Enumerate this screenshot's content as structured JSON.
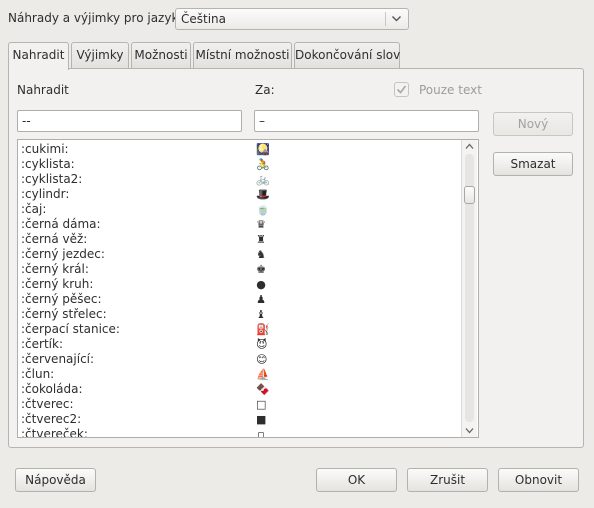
{
  "header": {
    "language_label": "Náhrady a výjimky pro jazyk:",
    "language_value": "Čeština"
  },
  "tabs": [
    {
      "label": "Nahradit",
      "active": true
    },
    {
      "label": "Výjimky",
      "active": false
    },
    {
      "label": "Možnosti",
      "active": false
    },
    {
      "label": "Místní možnosti",
      "active": false
    },
    {
      "label": "Dokončování slov",
      "active": false
    }
  ],
  "replace": {
    "col_replace_label": "Nahradit",
    "col_with_label": "Za:",
    "text_only_label": "Pouze text",
    "text_only_checked": true,
    "text_only_enabled": false,
    "replace_value": "--",
    "with_value": "–",
    "new_button": "Nový",
    "delete_button": "Smazat"
  },
  "list": [
    {
      "key": ":cukimi:",
      "value": "🎑"
    },
    {
      "key": ":cyklista:",
      "value": "🚴"
    },
    {
      "key": ":cyklista2:",
      "value": "🚲"
    },
    {
      "key": ":cylindr:",
      "value": "🎩"
    },
    {
      "key": ":čaj:",
      "value": "🍵"
    },
    {
      "key": ":černá dáma:",
      "value": "♛"
    },
    {
      "key": ":černá věž:",
      "value": "♜"
    },
    {
      "key": ":černý jezdec:",
      "value": "♞"
    },
    {
      "key": ":černý král:",
      "value": "♚"
    },
    {
      "key": ":černý kruh:",
      "value": "●"
    },
    {
      "key": ":černý pěšec:",
      "value": "♟"
    },
    {
      "key": ":černý střelec:",
      "value": "♝"
    },
    {
      "key": ":čerpací stanice:",
      "value": "⛽"
    },
    {
      "key": ":čertík:",
      "value": "😈"
    },
    {
      "key": ":červenající:",
      "value": "😊"
    },
    {
      "key": ":člun:",
      "value": "⛵"
    },
    {
      "key": ":čokoláda:",
      "value": "🍫"
    },
    {
      "key": ":čtverec:",
      "value": "□"
    },
    {
      "key": ":čtverec2:",
      "value": "■"
    },
    {
      "key": ":čtvereček:",
      "value": "▫"
    }
  ],
  "footer": {
    "help_button": "Nápověda",
    "ok_button": "OK",
    "cancel_button": "Zrušit",
    "reset_button": "Obnovit"
  }
}
